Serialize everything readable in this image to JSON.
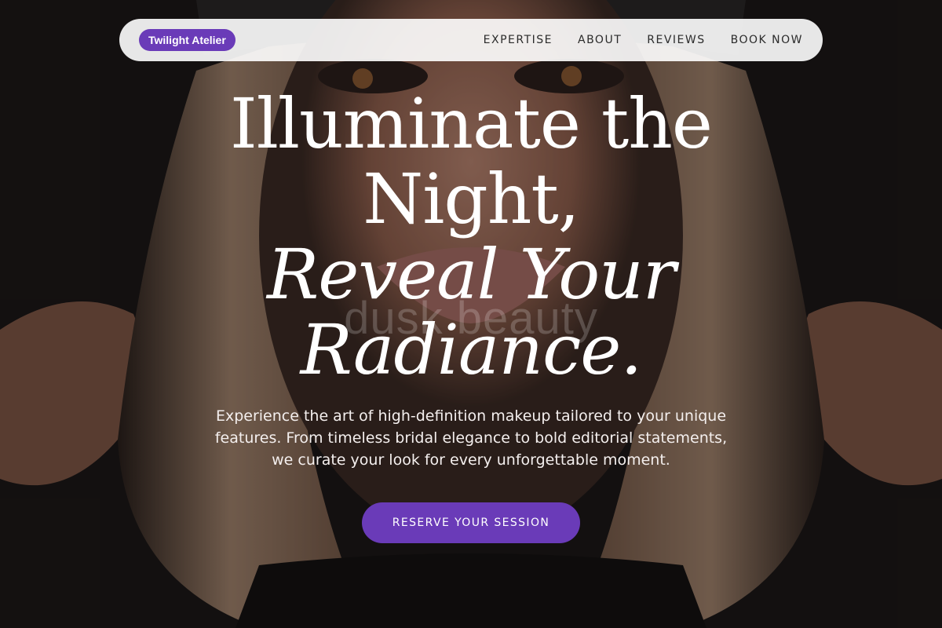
{
  "nav": {
    "brand": "Twilight Atelier",
    "links": [
      "EXPERTISE",
      "ABOUT",
      "REVIEWS",
      "BOOK NOW"
    ]
  },
  "hero": {
    "headline_line1": "Illuminate the",
    "headline_line2": "Night,",
    "headline_line3": "Reveal Your",
    "headline_line4": "Radiance.",
    "watermark": "dusk beauty",
    "description": "Experience the art of high-definition makeup tailored to your unique features. From timeless bridal elegance to bold editorial statements, we curate your look for every unforgettable moment.",
    "cta_label": "RESERVE YOUR SESSION"
  },
  "colors": {
    "accent": "#6a3bb8",
    "nav_background": "#f2f0f0",
    "text_light": "#ffffff"
  }
}
